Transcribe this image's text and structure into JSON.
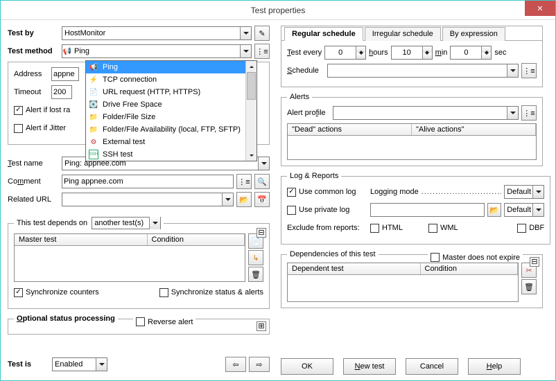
{
  "window": {
    "title": "Test properties",
    "close": "✕"
  },
  "testby": {
    "label": "Test by",
    "value": "HostMonitor"
  },
  "testmethod": {
    "label": "Test method",
    "value": "Ping",
    "options": [
      "Ping",
      "TCP connection",
      "URL request (HTTP, HTTPS)",
      "Drive Free Space",
      "Folder/File Size",
      "Folder/File Availability (local, FTP, SFTP)",
      "External test",
      "SSH test"
    ]
  },
  "address": {
    "label": "Address",
    "value": "appne"
  },
  "timeout": {
    "label": "Timeout",
    "value": "200"
  },
  "alert_lost": {
    "label": "Alert if lost ra",
    "checked": true
  },
  "alert_jitter": {
    "label": "Alert if Jitter",
    "checked": false
  },
  "testname": {
    "label": "Test name",
    "value": "Ping: appnee.com"
  },
  "comment": {
    "label": "Comment",
    "value": "Ping appnee.com"
  },
  "related_url": {
    "label": "Related URL",
    "value": ""
  },
  "schedule": {
    "tabs": [
      "Regular schedule",
      "Irregular schedule",
      "By expression"
    ],
    "test_every_label": "Test every",
    "hours_label": "hours",
    "hours_val": "0",
    "min_label": "min",
    "min_val": "10",
    "sec_label": "sec",
    "sec_val": "0",
    "schedule_label": "Schedule",
    "schedule_val": ""
  },
  "alerts": {
    "legend": "Alerts",
    "profile_label": "Alert profile",
    "profile_val": "",
    "dead_col": "\"Dead\" actions",
    "alive_col": "\"Alive actions\""
  },
  "log": {
    "legend": "Log & Reports",
    "use_common": "Use common log",
    "common_checked": true,
    "logging_mode": "Logging mode",
    "logging_dots": "....................................",
    "use_private": "Use private log",
    "private_checked": false,
    "private_path": "",
    "default": "Default",
    "exclude": "Exclude from reports:",
    "html": "HTML",
    "wml": "WML",
    "dbf": "DBF"
  },
  "depends": {
    "legend": "This test depends on",
    "dd_val": "another test(s)",
    "master_col": "Master test",
    "condition_col": "Condition",
    "sync_counters": "Synchronize counters",
    "sync_counters_checked": true,
    "sync_status": "Synchronize status & alerts",
    "sync_status_checked": false
  },
  "depof": {
    "legend": "Dependencies of this test",
    "master_no_expire": "Master does not expire",
    "dependent_col": "Dependent test",
    "condition_col": "Condition"
  },
  "optional": {
    "legend": "Optional status processing",
    "reverse": "Reverse alert",
    "reverse_checked": false
  },
  "testis": {
    "label": "Test is",
    "value": "Enabled"
  },
  "buttons": {
    "ok": "OK",
    "new": "New test",
    "cancel": "Cancel",
    "help": "Help"
  },
  "arrows": {
    "left": "⇦",
    "right": "⇨"
  }
}
